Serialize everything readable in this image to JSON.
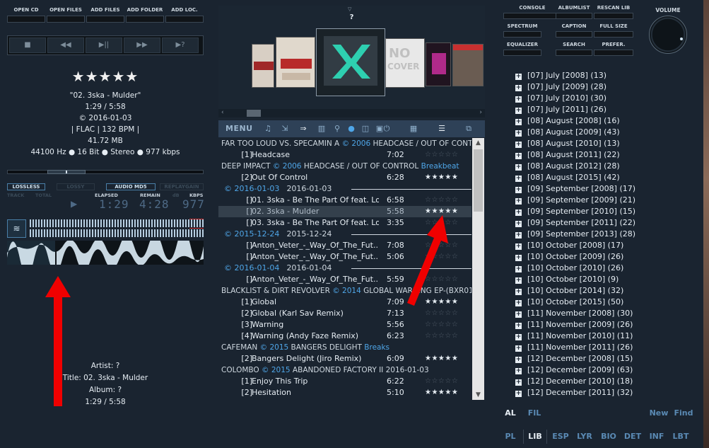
{
  "top_buttons": [
    "OPEN CD",
    "OPEN FILES",
    "ADD FILES",
    "ADD FOLDER",
    "ADD LOC."
  ],
  "transport_icons": [
    "■",
    "◀◀",
    "▶||",
    "▶▶",
    "▶?"
  ],
  "now_playing": {
    "rating": "★★★★★",
    "title_line": "\"02. 3ska - Mulder\"",
    "position": "1:29 / 5:58",
    "date_line": "© 2016-01-03",
    "format_line": "| FLAC | 132 BPM |",
    "size": "41.72 MB",
    "tech_line": "44100 Hz ● 16 Bit ● Stereo ● 977 kbps"
  },
  "badges": {
    "lossless": "LOSSLESS",
    "lossy": "LOSSY",
    "audio_md5": "AUDIO MD5",
    "replaygain": "REPLAYGAIN"
  },
  "meters": {
    "track_lbl": "TRACK",
    "total_lbl": "TOTAL",
    "elapsed_lbl": "ELAPSED",
    "remain_lbl": "REMAIN",
    "db_lbl": "dB",
    "kbps_lbl": "KBPS",
    "elapsed": "1:29",
    "remain": "4:28",
    "kbps": "977"
  },
  "bottom_info": {
    "artist": "Artist: ?",
    "title": "Title: 02. 3ska - Mulder",
    "album": "Album: ?",
    "position": "1:29 / 5:58"
  },
  "covers": {
    "current_label": "?"
  },
  "toolbar": {
    "menu": "MENU"
  },
  "playlist": [
    {
      "kind": "group",
      "text": "FAR TOO LOUD VS. SPECAMIN A ",
      "year": "© 2006",
      "rest": " HEADCASE / OUT OF CONT"
    },
    {
      "kind": "track",
      "num": "[1]",
      "title": "Headcase",
      "time": "7:02",
      "stars": "☆☆☆☆☆",
      "rated": false
    },
    {
      "kind": "group",
      "text": "DEEP IMPACT ",
      "year": "© 2006",
      "rest": " HEADCASE / OUT OF CONTROL ",
      "genre": "Breakbeat"
    },
    {
      "kind": "track",
      "num": "[2]",
      "title": "Out Of Control",
      "time": "6:28",
      "stars": "★★★★★",
      "rated": true
    },
    {
      "kind": "date",
      "date": "© 2016-01-03",
      "plain": "2016-01-03"
    },
    {
      "kind": "track",
      "num": "[]",
      "title": "01. 3ska - Be The Part Of feat. Lo...",
      "time": "6:58",
      "stars": "☆☆☆☆☆",
      "rated": false
    },
    {
      "kind": "track",
      "num": "[]",
      "title": "02. 3ska - Mulder",
      "time": "5:58",
      "stars": "★★★★★",
      "rated": true,
      "selected": true
    },
    {
      "kind": "track",
      "num": "[]",
      "title": "03. 3ska - Be The Part Of feat. Lo...",
      "time": "3:35",
      "stars": "☆☆☆☆☆",
      "rated": false
    },
    {
      "kind": "date",
      "date": "© 2015-12-24",
      "plain": "2015-12-24"
    },
    {
      "kind": "track",
      "num": "[]",
      "title": "Anton_Veter_-_Way_Of_The_Fut...",
      "time": "7:08",
      "stars": "☆☆☆☆☆",
      "rated": false
    },
    {
      "kind": "track",
      "num": "[]",
      "title": "Anton_Veter_-_Way_Of_The_Fut...",
      "time": "5:06",
      "stars": "☆☆☆☆☆",
      "rated": false
    },
    {
      "kind": "date",
      "date": "© 2016-01-04",
      "plain": "2016-01-04"
    },
    {
      "kind": "track",
      "num": "[]",
      "title": "Anton_Veter_-_Way_Of_The_Fut...",
      "time": "5:59",
      "stars": "☆☆☆☆☆",
      "rated": false
    },
    {
      "kind": "group",
      "text": "BLACKLIST & DIRT REVOLVER ",
      "year": "© 2014",
      "rest": " GLOBAL WARNING EP-(BXR01"
    },
    {
      "kind": "track",
      "num": "[1]",
      "title": "Global",
      "time": "7:09",
      "stars": "★★★★★",
      "rated": true
    },
    {
      "kind": "track",
      "num": "[2]",
      "title": "Global (Karl Sav Remix)",
      "time": "7:13",
      "stars": "☆☆☆☆☆",
      "rated": false
    },
    {
      "kind": "track",
      "num": "[3]",
      "title": "Warning",
      "time": "5:56",
      "stars": "☆☆☆☆☆",
      "rated": false
    },
    {
      "kind": "track",
      "num": "[4]",
      "title": "Warning (Andy Faze Remix)",
      "time": "6:23",
      "stars": "☆☆☆☆☆",
      "rated": false
    },
    {
      "kind": "group",
      "text": "CAFEMAN ",
      "year": "© 2015",
      "rest": " BANGERS DELIGHT ",
      "genre": "Breaks"
    },
    {
      "kind": "track",
      "num": "[2]",
      "title": "Bangers Delight (Jiro Remix)",
      "time": "6:09",
      "stars": "★★★★★",
      "rated": true
    },
    {
      "kind": "group",
      "text": "COLOMBO ",
      "year": "© 2015",
      "rest": " ABANDONED FACTORY II  2016-01-03"
    },
    {
      "kind": "track",
      "num": "[1]",
      "title": "Enjoy This Trip",
      "time": "6:22",
      "stars": "☆☆☆☆☆",
      "rated": false
    },
    {
      "kind": "track",
      "num": "[2]",
      "title": "Hesitation",
      "time": "5:10",
      "stars": "★★★★★",
      "rated": true
    }
  ],
  "right_buttons": [
    "CONSOLE",
    "ALBUMLIST",
    "RESCAN LIB",
    "SPECTRUM",
    "CAPTION",
    "FULL SIZE",
    "EQUALIZER",
    "SEARCH",
    "PREFER."
  ],
  "volume_label": "VOLUME",
  "library": [
    "[07] July [2008] (13)",
    "[07] July [2009] (28)",
    "[07] July [2010] (30)",
    "[07] July [2011] (26)",
    "[08] August [2008] (16)",
    "[08] August [2009] (43)",
    "[08] August [2010] (13)",
    "[08] August [2011] (22)",
    "[08] August [2012] (28)",
    "[08] August [2015] (42)",
    "[09] September [2008] (17)",
    "[09] September [2009] (21)",
    "[09] September [2010] (15)",
    "[09] September [2011] (22)",
    "[09] September [2013] (28)",
    "[10] October [2008] (17)",
    "[10] October [2009] (26)",
    "[10] October [2010] (26)",
    "[10] October [2010] (9)",
    "[10] October [2014] (32)",
    "[10] October [2015] (50)",
    "[11] November [2008] (30)",
    "[11] November [2009] (26)",
    "[11] November [2010] (11)",
    "[11] November [2011] (26)",
    "[12] December [2008] (15)",
    "[12] December [2009] (63)",
    "[12] December [2010] (18)",
    "[12] December [2011] (32)"
  ],
  "lib_tabs_top": {
    "al": "AL",
    "fil": "FIL",
    "new": "New",
    "find": "Find"
  },
  "lib_tabs_bottom": [
    "PL",
    "LIB",
    "ESP",
    "LYR",
    "BIO",
    "DET",
    "INF",
    "LBT"
  ]
}
